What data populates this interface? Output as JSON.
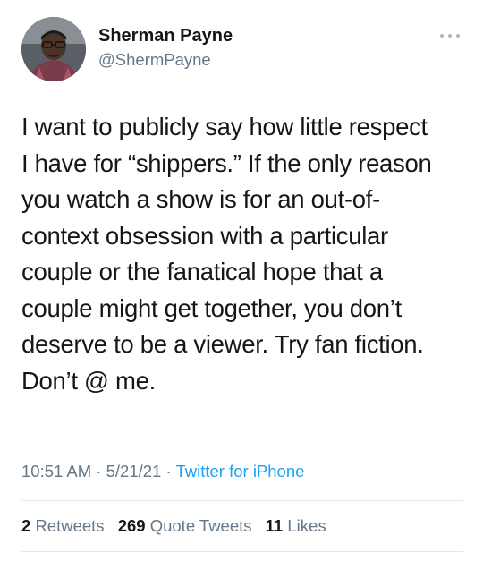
{
  "tweet": {
    "author": {
      "display_name": "Sherman Payne",
      "handle": "@ShermPayne",
      "avatar_icon": "profile-photo"
    },
    "text_lines": [
      "I want to publicly say how little respect",
      "I have for “shippers.” If the only reason",
      "you watch a show is for an out-of-",
      "context obsession with a particular",
      "couple or the fanatical hope that a",
      "couple might get together, you don’t",
      "deserve to be a viewer. Try fan fiction.",
      "Don’t @ me."
    ],
    "time": "10:51 AM",
    "sep1": " · ",
    "date": "5/21/21",
    "sep2": " · ",
    "source": "Twitter for iPhone",
    "stats": {
      "retweets_count": "2",
      "retweets_label": "Retweets",
      "quotes_count": "269",
      "quotes_label": "Quote Tweets",
      "likes_count": "11",
      "likes_label": "Likes"
    },
    "colors": {
      "link": "#1da1f2",
      "secondary_text": "#657786",
      "primary_text": "#14171a"
    }
  }
}
